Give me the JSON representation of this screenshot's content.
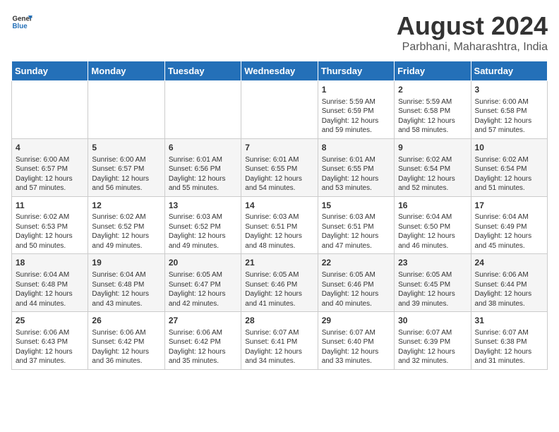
{
  "header": {
    "logo_line1": "General",
    "logo_line2": "Blue",
    "main_title": "August 2024",
    "subtitle": "Parbhani, Maharashtra, India"
  },
  "calendar": {
    "days_of_week": [
      "Sunday",
      "Monday",
      "Tuesday",
      "Wednesday",
      "Thursday",
      "Friday",
      "Saturday"
    ],
    "weeks": [
      [
        {
          "day": "",
          "info": ""
        },
        {
          "day": "",
          "info": ""
        },
        {
          "day": "",
          "info": ""
        },
        {
          "day": "",
          "info": ""
        },
        {
          "day": "1",
          "info": "Sunrise: 5:59 AM\nSunset: 6:59 PM\nDaylight: 12 hours\nand 59 minutes."
        },
        {
          "day": "2",
          "info": "Sunrise: 5:59 AM\nSunset: 6:58 PM\nDaylight: 12 hours\nand 58 minutes."
        },
        {
          "day": "3",
          "info": "Sunrise: 6:00 AM\nSunset: 6:58 PM\nDaylight: 12 hours\nand 57 minutes."
        }
      ],
      [
        {
          "day": "4",
          "info": "Sunrise: 6:00 AM\nSunset: 6:57 PM\nDaylight: 12 hours\nand 57 minutes."
        },
        {
          "day": "5",
          "info": "Sunrise: 6:00 AM\nSunset: 6:57 PM\nDaylight: 12 hours\nand 56 minutes."
        },
        {
          "day": "6",
          "info": "Sunrise: 6:01 AM\nSunset: 6:56 PM\nDaylight: 12 hours\nand 55 minutes."
        },
        {
          "day": "7",
          "info": "Sunrise: 6:01 AM\nSunset: 6:55 PM\nDaylight: 12 hours\nand 54 minutes."
        },
        {
          "day": "8",
          "info": "Sunrise: 6:01 AM\nSunset: 6:55 PM\nDaylight: 12 hours\nand 53 minutes."
        },
        {
          "day": "9",
          "info": "Sunrise: 6:02 AM\nSunset: 6:54 PM\nDaylight: 12 hours\nand 52 minutes."
        },
        {
          "day": "10",
          "info": "Sunrise: 6:02 AM\nSunset: 6:54 PM\nDaylight: 12 hours\nand 51 minutes."
        }
      ],
      [
        {
          "day": "11",
          "info": "Sunrise: 6:02 AM\nSunset: 6:53 PM\nDaylight: 12 hours\nand 50 minutes."
        },
        {
          "day": "12",
          "info": "Sunrise: 6:02 AM\nSunset: 6:52 PM\nDaylight: 12 hours\nand 49 minutes."
        },
        {
          "day": "13",
          "info": "Sunrise: 6:03 AM\nSunset: 6:52 PM\nDaylight: 12 hours\nand 49 minutes."
        },
        {
          "day": "14",
          "info": "Sunrise: 6:03 AM\nSunset: 6:51 PM\nDaylight: 12 hours\nand 48 minutes."
        },
        {
          "day": "15",
          "info": "Sunrise: 6:03 AM\nSunset: 6:51 PM\nDaylight: 12 hours\nand 47 minutes."
        },
        {
          "day": "16",
          "info": "Sunrise: 6:04 AM\nSunset: 6:50 PM\nDaylight: 12 hours\nand 46 minutes."
        },
        {
          "day": "17",
          "info": "Sunrise: 6:04 AM\nSunset: 6:49 PM\nDaylight: 12 hours\nand 45 minutes."
        }
      ],
      [
        {
          "day": "18",
          "info": "Sunrise: 6:04 AM\nSunset: 6:48 PM\nDaylight: 12 hours\nand 44 minutes."
        },
        {
          "day": "19",
          "info": "Sunrise: 6:04 AM\nSunset: 6:48 PM\nDaylight: 12 hours\nand 43 minutes."
        },
        {
          "day": "20",
          "info": "Sunrise: 6:05 AM\nSunset: 6:47 PM\nDaylight: 12 hours\nand 42 minutes."
        },
        {
          "day": "21",
          "info": "Sunrise: 6:05 AM\nSunset: 6:46 PM\nDaylight: 12 hours\nand 41 minutes."
        },
        {
          "day": "22",
          "info": "Sunrise: 6:05 AM\nSunset: 6:46 PM\nDaylight: 12 hours\nand 40 minutes."
        },
        {
          "day": "23",
          "info": "Sunrise: 6:05 AM\nSunset: 6:45 PM\nDaylight: 12 hours\nand 39 minutes."
        },
        {
          "day": "24",
          "info": "Sunrise: 6:06 AM\nSunset: 6:44 PM\nDaylight: 12 hours\nand 38 minutes."
        }
      ],
      [
        {
          "day": "25",
          "info": "Sunrise: 6:06 AM\nSunset: 6:43 PM\nDaylight: 12 hours\nand 37 minutes."
        },
        {
          "day": "26",
          "info": "Sunrise: 6:06 AM\nSunset: 6:42 PM\nDaylight: 12 hours\nand 36 minutes."
        },
        {
          "day": "27",
          "info": "Sunrise: 6:06 AM\nSunset: 6:42 PM\nDaylight: 12 hours\nand 35 minutes."
        },
        {
          "day": "28",
          "info": "Sunrise: 6:07 AM\nSunset: 6:41 PM\nDaylight: 12 hours\nand 34 minutes."
        },
        {
          "day": "29",
          "info": "Sunrise: 6:07 AM\nSunset: 6:40 PM\nDaylight: 12 hours\nand 33 minutes."
        },
        {
          "day": "30",
          "info": "Sunrise: 6:07 AM\nSunset: 6:39 PM\nDaylight: 12 hours\nand 32 minutes."
        },
        {
          "day": "31",
          "info": "Sunrise: 6:07 AM\nSunset: 6:38 PM\nDaylight: 12 hours\nand 31 minutes."
        }
      ]
    ]
  }
}
